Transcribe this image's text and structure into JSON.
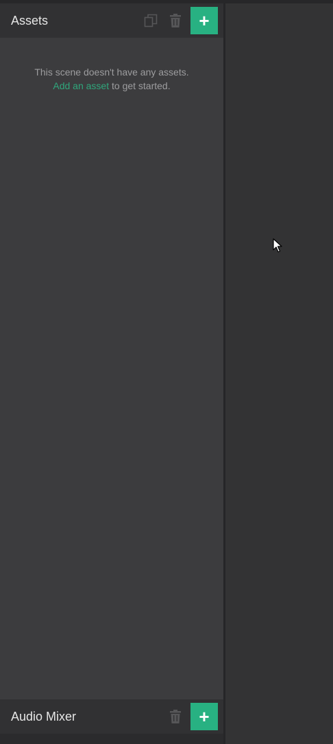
{
  "assets_panel": {
    "title": "Assets",
    "empty_line1": "This scene doesn't have any assets.",
    "add_link": "Add an asset",
    "empty_line2_suffix": " to get started.",
    "icons": [
      "copy-icon",
      "trash-icon",
      "plus-icon"
    ]
  },
  "audio_mixer_panel": {
    "title": "Audio Mixer",
    "icons": [
      "trash-icon",
      "plus-icon"
    ]
  },
  "colors": {
    "accent": "#28b182",
    "link": "#2fa77c",
    "panel_bg": "#3c3c3e",
    "header_bg": "#313133"
  }
}
